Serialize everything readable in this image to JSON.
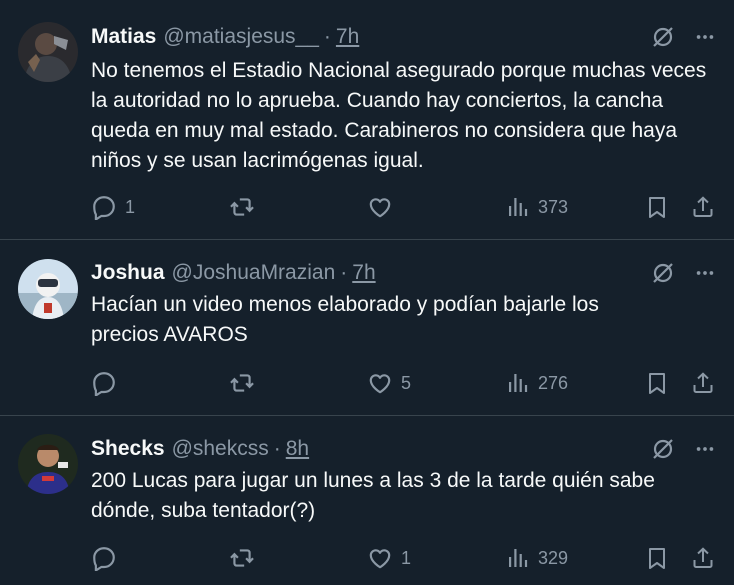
{
  "colors": {
    "background": "#15202b",
    "divider": "#38444d",
    "text_primary": "#f7f9f9",
    "text_secondary": "#8b98a5"
  },
  "tweets": [
    {
      "name": "Matias",
      "handle": "@matiasjesus__",
      "separator": "·",
      "time": "7h",
      "text": "No tenemos el Estadio Nacional asegurado porque muchas veces la autoridad no lo aprueba. Cuando hay conciertos, la cancha queda en muy mal estado. Carabineros no considera que haya niños y se usan lacrimógenas igual.",
      "replies": "1",
      "reposts": "",
      "likes": "",
      "views": "373",
      "icons": [
        "reply-icon",
        "repost-icon",
        "like-icon",
        "views-icon",
        "bookmark-icon",
        "share-icon",
        "grok-icon",
        "more-icon"
      ]
    },
    {
      "name": "Joshua",
      "handle": "@JoshuaMrazian",
      "separator": "·",
      "time": "7h",
      "text": "Hacían un video menos elaborado y podían bajarle los precios AVAROS",
      "replies": "",
      "reposts": "",
      "likes": "5",
      "views": "276",
      "icons": [
        "reply-icon",
        "repost-icon",
        "like-icon",
        "views-icon",
        "bookmark-icon",
        "share-icon",
        "grok-icon",
        "more-icon"
      ]
    },
    {
      "name": "Shecks",
      "handle": "@shekcss",
      "separator": "·",
      "time": "8h",
      "text": "200 Lucas para jugar un lunes a las 3 de la tarde quién sabe dónde, suba tentador(?)",
      "replies": "",
      "reposts": "",
      "likes": "1",
      "views": "329",
      "icons": [
        "reply-icon",
        "repost-icon",
        "like-icon",
        "views-icon",
        "bookmark-icon",
        "share-icon",
        "grok-icon",
        "more-icon"
      ]
    }
  ]
}
